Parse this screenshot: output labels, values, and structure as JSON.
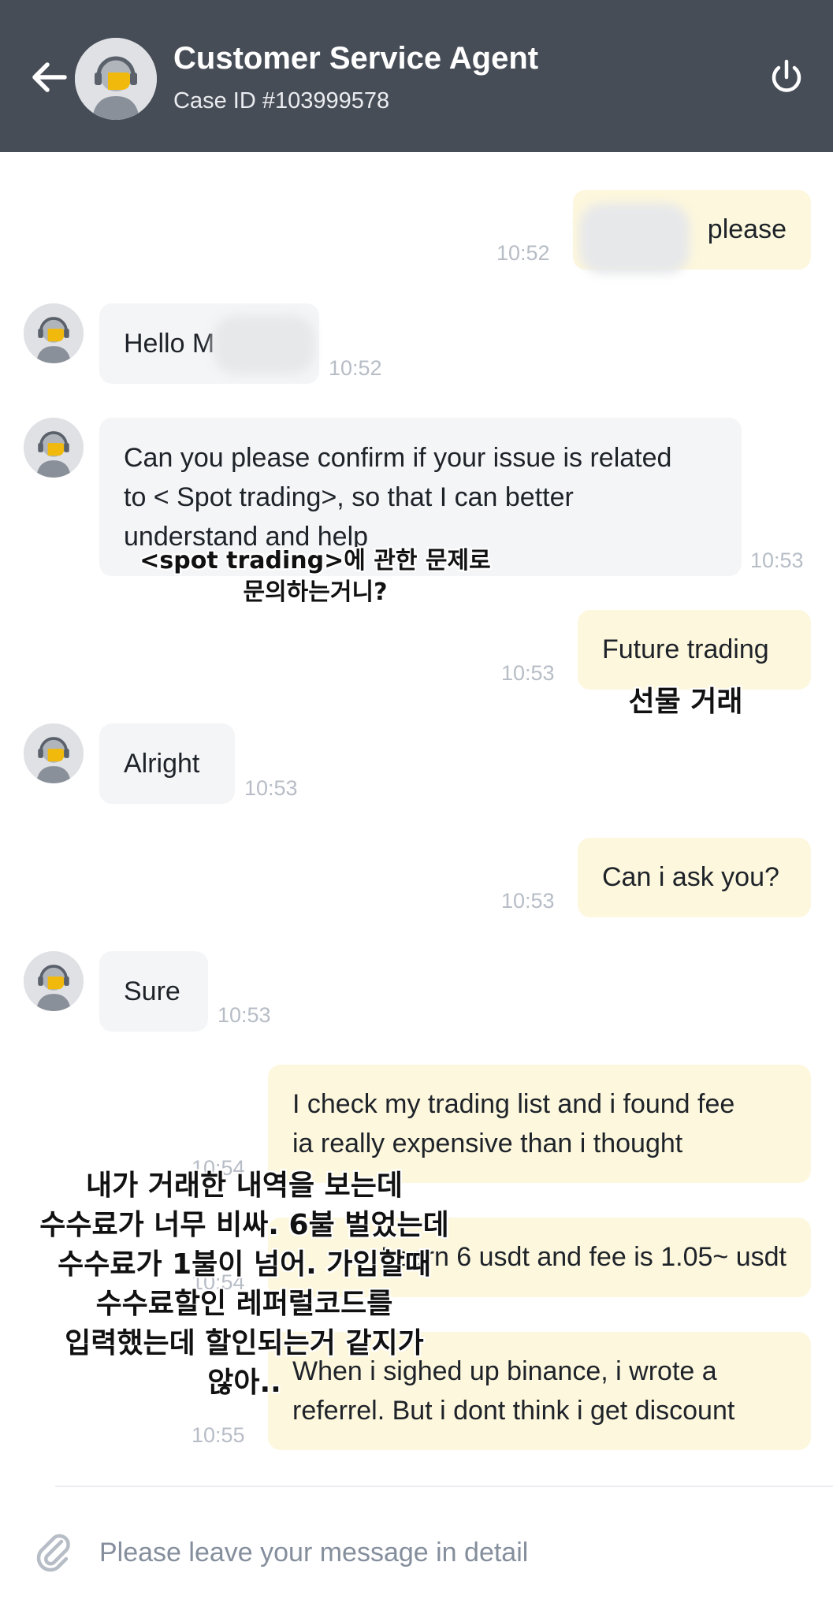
{
  "header": {
    "agent_name": "Customer Service Agent",
    "case_id": "Case ID #103999578"
  },
  "messages": [
    {
      "sender": "user",
      "text": "please",
      "time": "10:52"
    },
    {
      "sender": "agent",
      "text": "Hello M",
      "time": "10:52"
    },
    {
      "sender": "agent",
      "lines": [
        "Can you please confirm if your issue is related",
        "to < Spot trading>, so that I can better",
        "understand and help"
      ],
      "time": "10:53"
    },
    {
      "sender": "user",
      "text": "Future trading",
      "time": "10:53"
    },
    {
      "sender": "agent",
      "text": "Alright",
      "time": "10:53"
    },
    {
      "sender": "user",
      "text": "Can i ask you?",
      "time": "10:53"
    },
    {
      "sender": "agent",
      "text": "Sure",
      "time": "10:53"
    },
    {
      "sender": "user",
      "lines": [
        "I check my trading list and i found fee",
        "ia really expensive than i thought"
      ],
      "time": "10:54"
    },
    {
      "sender": "user",
      "text": "I earn 6 usdt and fee is 1.05~ usdt",
      "time": "10:54"
    },
    {
      "sender": "user",
      "lines": [
        "When i sighed up binance, i wrote a",
        "referrel. But i dont think i get discount"
      ],
      "time": "10:55"
    }
  ],
  "overlays": {
    "spot_question": [
      "<spot trading>에 관한 문제로",
      "문의하는거니?"
    ],
    "futures": "선물 거래",
    "fee_complaint": [
      "내가 거래한 내역을 보는데",
      "수수료가 너무 비싸. 6불 벌었는데",
      "수수료가 1불이 넘어. 가입할때",
      "수수료할인 레퍼럴코드를",
      "입력했는데 할인되는거 같지가",
      "않아.."
    ]
  },
  "input": {
    "placeholder": "Please leave your message in detail"
  },
  "icons": {
    "back": "arrow-left-icon",
    "power": "power-icon",
    "attach": "paperclip-icon"
  },
  "colors": {
    "header_bg": "#474d57",
    "agent_bubble": "#f4f5f7",
    "user_bubble": "#fdf7dd",
    "accent": "#f0b90b"
  }
}
